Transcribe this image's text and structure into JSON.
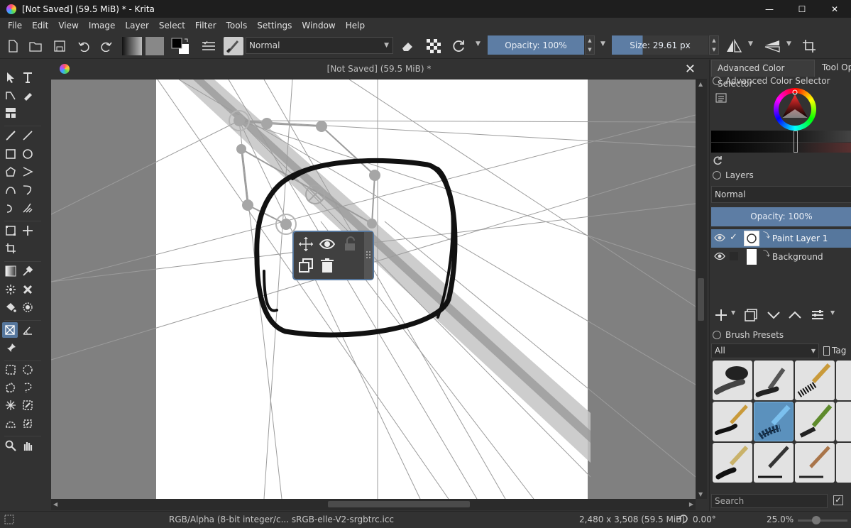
{
  "window": {
    "title": "[Not Saved]  (59.5 MiB) * - Krita",
    "minimize": "—",
    "maximize": "☐",
    "close": "✕"
  },
  "menu": [
    "File",
    "Edit",
    "View",
    "Image",
    "Layer",
    "Select",
    "Filter",
    "Tools",
    "Settings",
    "Window",
    "Help"
  ],
  "toolbar": {
    "blend_mode": "Normal",
    "opacity": "Opacity: 100%",
    "size": "Size: 29.61 px"
  },
  "document": {
    "tab_title": "[Not Saved]  (59.5 MiB) *",
    "close": "✕"
  },
  "dock": {
    "tabs": [
      "Advanced Color Selector",
      "Tool Opt"
    ],
    "color_selector_title": "Advanced Color Selector",
    "layers_title": "Layers",
    "layers_blend": "Normal",
    "layers_opacity": "Opacity: 100%",
    "layers": [
      {
        "name": "Paint Layer 1",
        "selected": true
      },
      {
        "name": "Background",
        "selected": false
      }
    ],
    "brush_presets_title": "Brush Presets",
    "brush_filter": "All",
    "tag_label": "Tag",
    "search_placeholder": "Search"
  },
  "status": {
    "color_model": "RGB/Alpha (8-bit integer/c...  sRGB-elle-V2-srgbtrc.icc",
    "dimensions": "2,480 x 3,508 (59.5 MiB)",
    "rotation": "0.00°",
    "zoom": "25.0%"
  },
  "colors": {
    "accent": "#56779d",
    "background": "#323232",
    "canvas_bg": "#808080"
  }
}
